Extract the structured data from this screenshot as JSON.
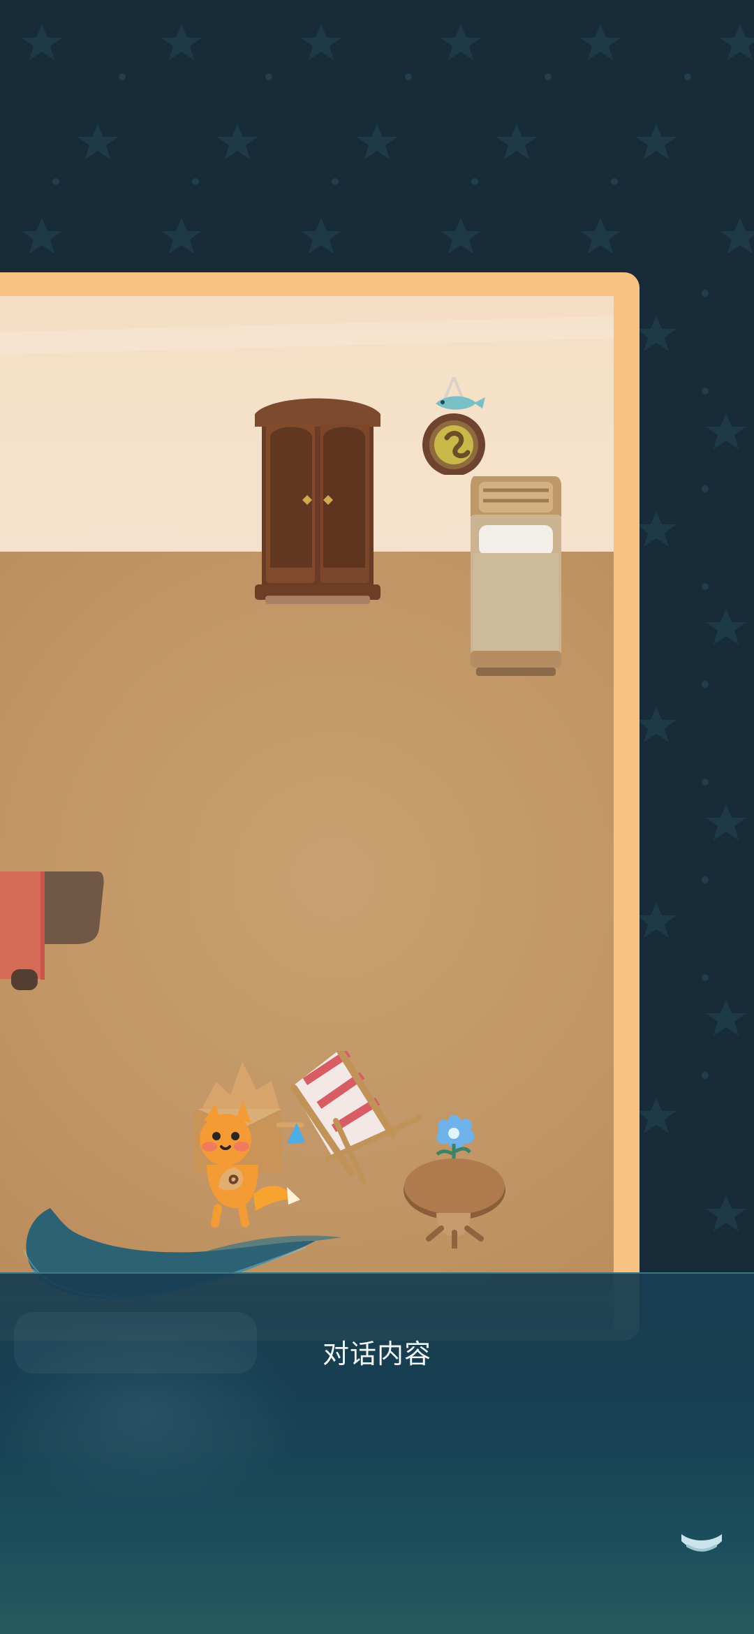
{
  "dialog": {
    "text": "对话内容"
  },
  "icons": {
    "continue": "chevron-down-icon"
  },
  "colors": {
    "background": "#182b39",
    "frame": "#f7c383",
    "dialog_text": "#f4f7f8"
  }
}
